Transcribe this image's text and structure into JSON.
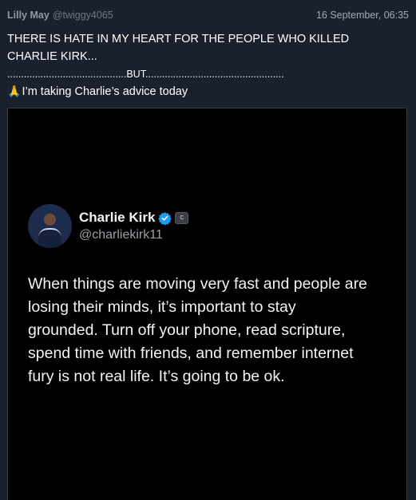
{
  "post": {
    "author_name": "Lilly May",
    "author_handle": "@twiggy4065",
    "timestamp": "16 September, 06:35",
    "lines": [
      "THERE IS HATE IN MY HEART FOR THE PEOPLE WHO KILLED",
      "CHARLIE KIRK...",
      "...........................................BUT..................................................",
      "I’m taking Charlie’s advice today"
    ],
    "emoji": "🙏"
  },
  "embed": {
    "display_name": "Charlie Kirk",
    "handle": "@charliekirk11",
    "verified_icon": "verified-badge-icon",
    "affiliation_icon": "affiliation-badge-icon",
    "affiliation_glyph": "C",
    "body_lines": [
      "When things are moving very fast and people are",
      "losing their minds, it’s important to stay",
      "grounded. Turn off your phone, read scripture,",
      "spend time with friends, and remember internet",
      "fury is not real life. It’s going to be ok."
    ]
  },
  "colors": {
    "page_bg": "#1b212c",
    "embed_bg": "#000000",
    "verified_blue": "#1d9bf0"
  }
}
